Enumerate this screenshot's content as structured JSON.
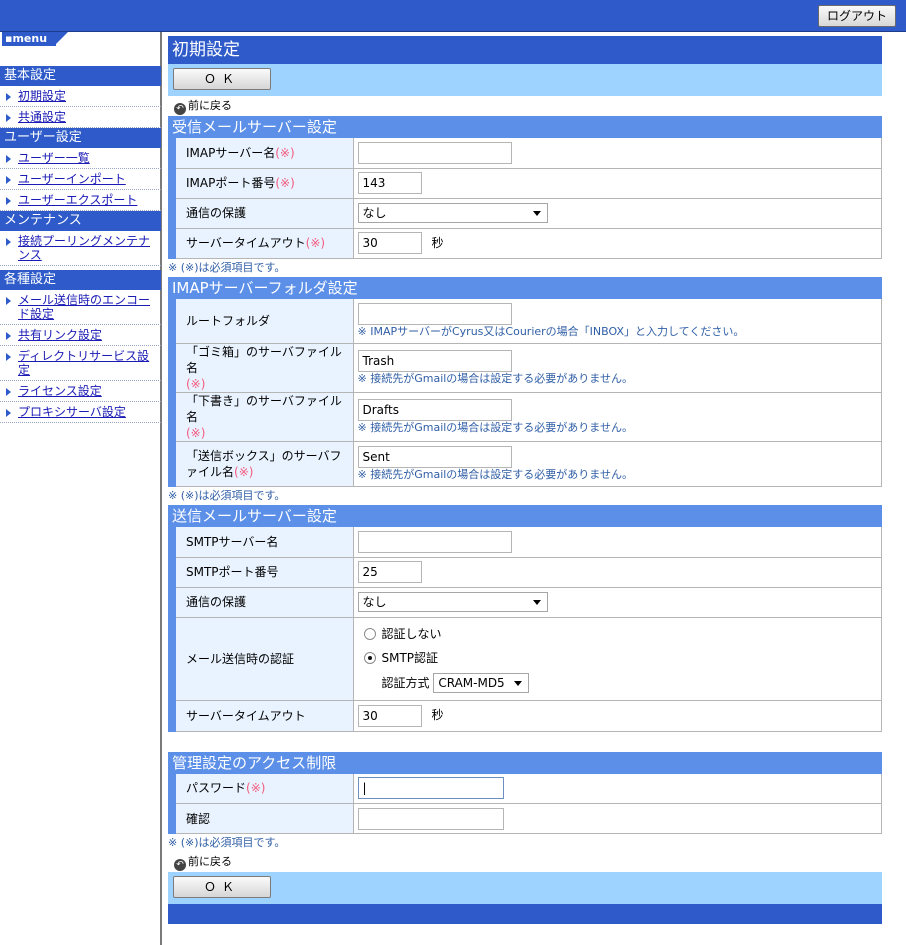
{
  "header": {
    "logout_label": "ログアウト"
  },
  "sidebar": {
    "logo": "menu",
    "sections": [
      {
        "title": "基本設定",
        "items": [
          "初期設定",
          "共通設定"
        ]
      },
      {
        "title": "ユーザー設定",
        "items": [
          "ユーザー一覧",
          "ユーザーインポート",
          "ユーザーエクスポート"
        ]
      },
      {
        "title": "メンテナンス",
        "items": [
          "接続プーリングメンテナンス"
        ]
      },
      {
        "title": "各種設定",
        "items": [
          "メール送信時のエンコード設定",
          "共有リンク設定",
          "ディレクトリサービス設定",
          "ライセンス設定",
          "プロキシサーバ設定"
        ]
      }
    ]
  },
  "page": {
    "title": "初期設定",
    "ok_label": "ＯＫ",
    "back_label": "前に戻る",
    "req_mark": "(※)",
    "req_note": "※ (※)は必須項目です。",
    "seconds": "秒"
  },
  "imap": {
    "title": "受信メールサーバー設定",
    "server_label": "IMAPサーバー名",
    "server_value": "",
    "port_label": "IMAPポート番号",
    "port_value": "143",
    "security_label": "通信の保護",
    "security_value": "なし",
    "timeout_label": "サーバータイムアウト",
    "timeout_value": "30"
  },
  "folders": {
    "title": "IMAPサーバーフォルダ設定",
    "root_label": "ルートフォルダ",
    "root_value": "",
    "root_hint": "※ IMAPサーバーがCyrus又はCourierの場合「INBOX」と入力してください。",
    "trash_label": "「ゴミ箱」のサーバファイル名",
    "trash_value": "Trash",
    "drafts_label": "「下書き」のサーバファイル名",
    "drafts_value": "Drafts",
    "sent_label": "「送信ボックス」のサーバファイル名",
    "sent_value": "Sent",
    "gmail_hint": "※ 接続先がGmailの場合は設定する必要がありません。"
  },
  "smtp": {
    "title": "送信メールサーバー設定",
    "server_label": "SMTPサーバー名",
    "server_value": "",
    "port_label": "SMTPポート番号",
    "port_value": "25",
    "security_label": "通信の保護",
    "security_value": "なし",
    "auth_label": "メール送信時の認証",
    "auth_none": "認証しない",
    "auth_smtp": "SMTP認証",
    "auth_selected": "SMTP認証",
    "auth_method_label": "認証方式",
    "auth_method_value": "CRAM-MD5",
    "timeout_label": "サーバータイムアウト",
    "timeout_value": "30"
  },
  "access": {
    "title": "管理設定のアクセス制限",
    "password_label": "パスワード",
    "password_value": "",
    "confirm_label": "確認",
    "confirm_value": ""
  }
}
